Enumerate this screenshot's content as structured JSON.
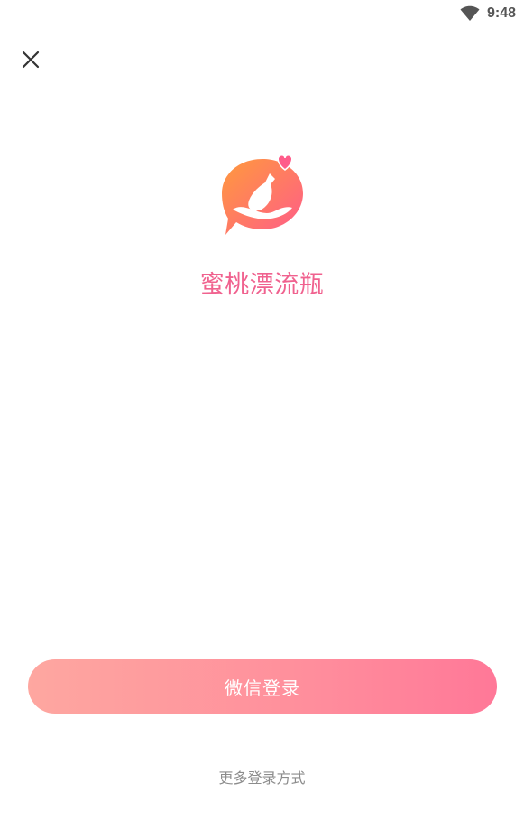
{
  "status_bar": {
    "time": "9:48",
    "icons": [
      "wifi-icon"
    ]
  },
  "header": {
    "close_icon": "close-icon"
  },
  "brand": {
    "app_name": "蜜桃漂流瓶",
    "logo_icon": "bottle-chat-bubble-logo",
    "colors": {
      "gradient_start": "#ff9a3c",
      "gradient_end": "#ff5c8a",
      "heart": "#ff5c8a",
      "app_name": "#f0628f"
    }
  },
  "login": {
    "wechat_label": "微信登录",
    "wechat_button_gradient": [
      "#fea7a0",
      "#ff7898"
    ],
    "more_options_label": "更多登录方式"
  }
}
